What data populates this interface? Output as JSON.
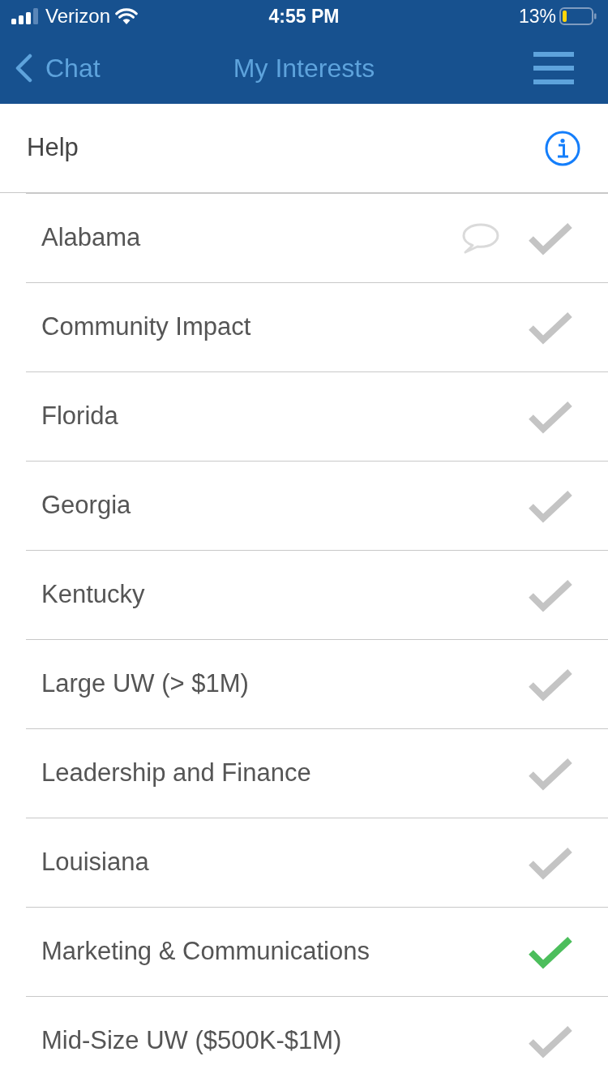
{
  "status_bar": {
    "carrier": "Verizon",
    "time": "4:55 PM",
    "battery": "13%"
  },
  "nav_bar": {
    "back_label": "Chat",
    "title": "My Interests"
  },
  "help_row": {
    "label": "Help"
  },
  "interests": [
    {
      "label": "Alabama",
      "has_chat": true,
      "checked": false
    },
    {
      "label": "Community Impact",
      "has_chat": false,
      "checked": false
    },
    {
      "label": "Florida",
      "has_chat": false,
      "checked": false
    },
    {
      "label": "Georgia",
      "has_chat": false,
      "checked": false
    },
    {
      "label": "Kentucky",
      "has_chat": false,
      "checked": false
    },
    {
      "label": "Large UW (> $1M)",
      "has_chat": false,
      "checked": false
    },
    {
      "label": "Leadership and Finance",
      "has_chat": false,
      "checked": false
    },
    {
      "label": "Louisiana",
      "has_chat": false,
      "checked": false
    },
    {
      "label": "Marketing & Communications",
      "has_chat": false,
      "checked": true
    },
    {
      "label": "Mid-Size UW ($500K-$1M)",
      "has_chat": false,
      "checked": false
    }
  ]
}
